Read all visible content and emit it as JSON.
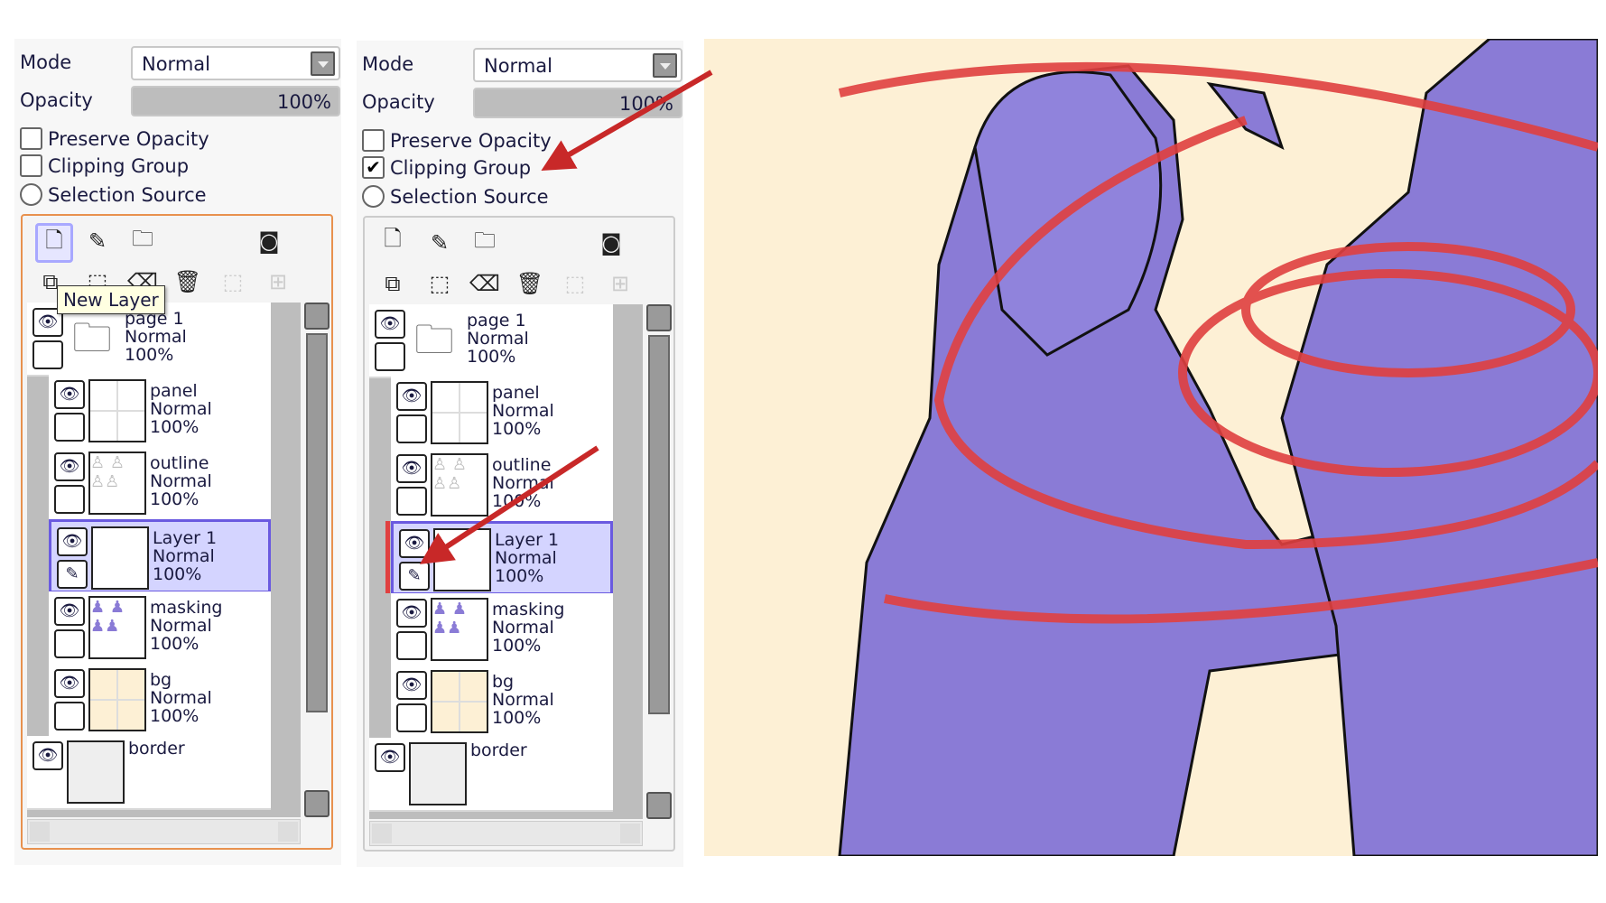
{
  "panels": [
    {
      "mode_label": "Mode",
      "mode_value": "Normal",
      "opacity_label": "Opacity",
      "opacity_value": "100%",
      "preserve_opacity": "Preserve Opacity",
      "clipping_group": "Clipping Group",
      "selection_source": "Selection Source",
      "clipping_checked": false,
      "check_glyph": "",
      "tooltip": "New Layer",
      "layers": [
        {
          "name": "page 1",
          "mode": "Normal",
          "opacity": "100%",
          "type": "folder"
        },
        {
          "name": "panel",
          "mode": "Normal",
          "opacity": "100%",
          "type": "panel"
        },
        {
          "name": "outline",
          "mode": "Normal",
          "opacity": "100%",
          "type": "outline"
        },
        {
          "name": "Layer 1",
          "mode": "Normal",
          "opacity": "100%",
          "type": "blank",
          "selected": true
        },
        {
          "name": "masking",
          "mode": "Normal",
          "opacity": "100%",
          "type": "masking"
        },
        {
          "name": "bg",
          "mode": "Normal",
          "opacity": "100%",
          "type": "bg"
        },
        {
          "name": "border",
          "mode": "",
          "opacity": "",
          "type": "border"
        }
      ]
    },
    {
      "mode_label": "Mode",
      "mode_value": "Normal",
      "opacity_label": "Opacity",
      "opacity_value": "100%",
      "preserve_opacity": "Preserve Opacity",
      "clipping_group": "Clipping Group",
      "selection_source": "Selection Source",
      "clipping_checked": true,
      "check_glyph": "✔",
      "layers": [
        {
          "name": "page 1",
          "mode": "Normal",
          "opacity": "100%",
          "type": "folder"
        },
        {
          "name": "panel",
          "mode": "Normal",
          "opacity": "100%",
          "type": "panel"
        },
        {
          "name": "outline",
          "mode": "Normal",
          "opacity": "100%",
          "type": "outline"
        },
        {
          "name": "Layer 1",
          "mode": "Normal",
          "opacity": "100%",
          "type": "blank",
          "selected": true,
          "clipped": true
        },
        {
          "name": "masking",
          "mode": "Normal",
          "opacity": "100%",
          "type": "masking"
        },
        {
          "name": "bg",
          "mode": "Normal",
          "opacity": "100%",
          "type": "bg"
        },
        {
          "name": "border",
          "mode": "",
          "opacity": "",
          "type": "border"
        }
      ]
    }
  ],
  "icons": {
    "eye": "eye-icon",
    "pen": "pen-icon"
  },
  "colors": {
    "canvas_bg": "#fdf0d5",
    "fill": "#8a7bd6",
    "clip_red": "#e04040",
    "arrow": "#c82828",
    "selected": "#d4d4ff",
    "active_border": "#e8914e"
  }
}
